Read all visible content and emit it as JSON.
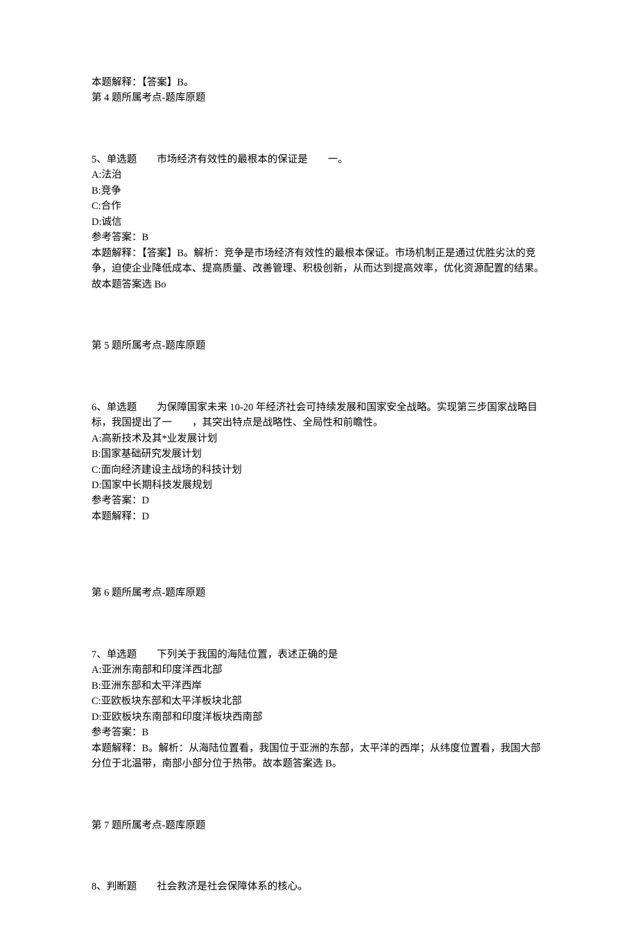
{
  "q4": {
    "expl": "本题解释：【答案】B。",
    "src": "第 4 题所属考点-题库原题"
  },
  "q5": {
    "header": "5、单选题　　市场经济有效性的最根本的保证是　　一。",
    "opts": {
      "a": "A:法治",
      "b": "B:竞争",
      "c": "C:合作",
      "d": "D:诚信"
    },
    "ans": "参考答案：B",
    "expl": "本题解释：【答案】B。解析：竞争是市场经济有效性的最根本保证。市场机制正是通过优胜劣汰的竞争，迫使企业降低成本、提高质量、改善管理、积极创新，从而达到提高效率，优化资源配置的结果。故本题答案选 Bo",
    "src": "第 5 题所属考点-题库原题"
  },
  "q6": {
    "header": "6、单选题　　为保障国家未来 10-20 年经济社会可持续发展和国家安全战略。实现第三步国家战略目标，我国提出了一　　，其突出特点是战略性、全局性和前瞻性。",
    "opts": {
      "a": "A:高新技术及其*业发展计划",
      "b": "B:国家基础研究发展计划",
      "c": "C:面向经济建设主战场的科技计划",
      "d": "D:国家中长期科技发展规划"
    },
    "ans": "参考答案：D",
    "expl": "本题解释：D",
    "src": "第 6 题所属考点-题库原题"
  },
  "q7": {
    "header": "7、单选题　　下列关于我国的海陆位置，表述正确的是",
    "opts": {
      "a": "A:亚洲东南部和印度洋西北部",
      "b": "B:亚洲东部和太平洋西岸",
      "c": "C:亚欧板块东部和太平洋板块北部",
      "d": "D:亚欧板块东南部和印度洋板块西南部"
    },
    "ans": "参考答案：B",
    "expl": "本题解释：B。解析：从海陆位置看，我国位于亚洲的东部，太平洋的西岸；从纬度位置看，我国大部分位于北温带，南部小部分位于热带。故本题答案选 B。",
    "src": "第 7 题所属考点-题库原题"
  },
  "q8": {
    "header": "8、判断题　　社会救济是社会保障体系的核心。"
  }
}
